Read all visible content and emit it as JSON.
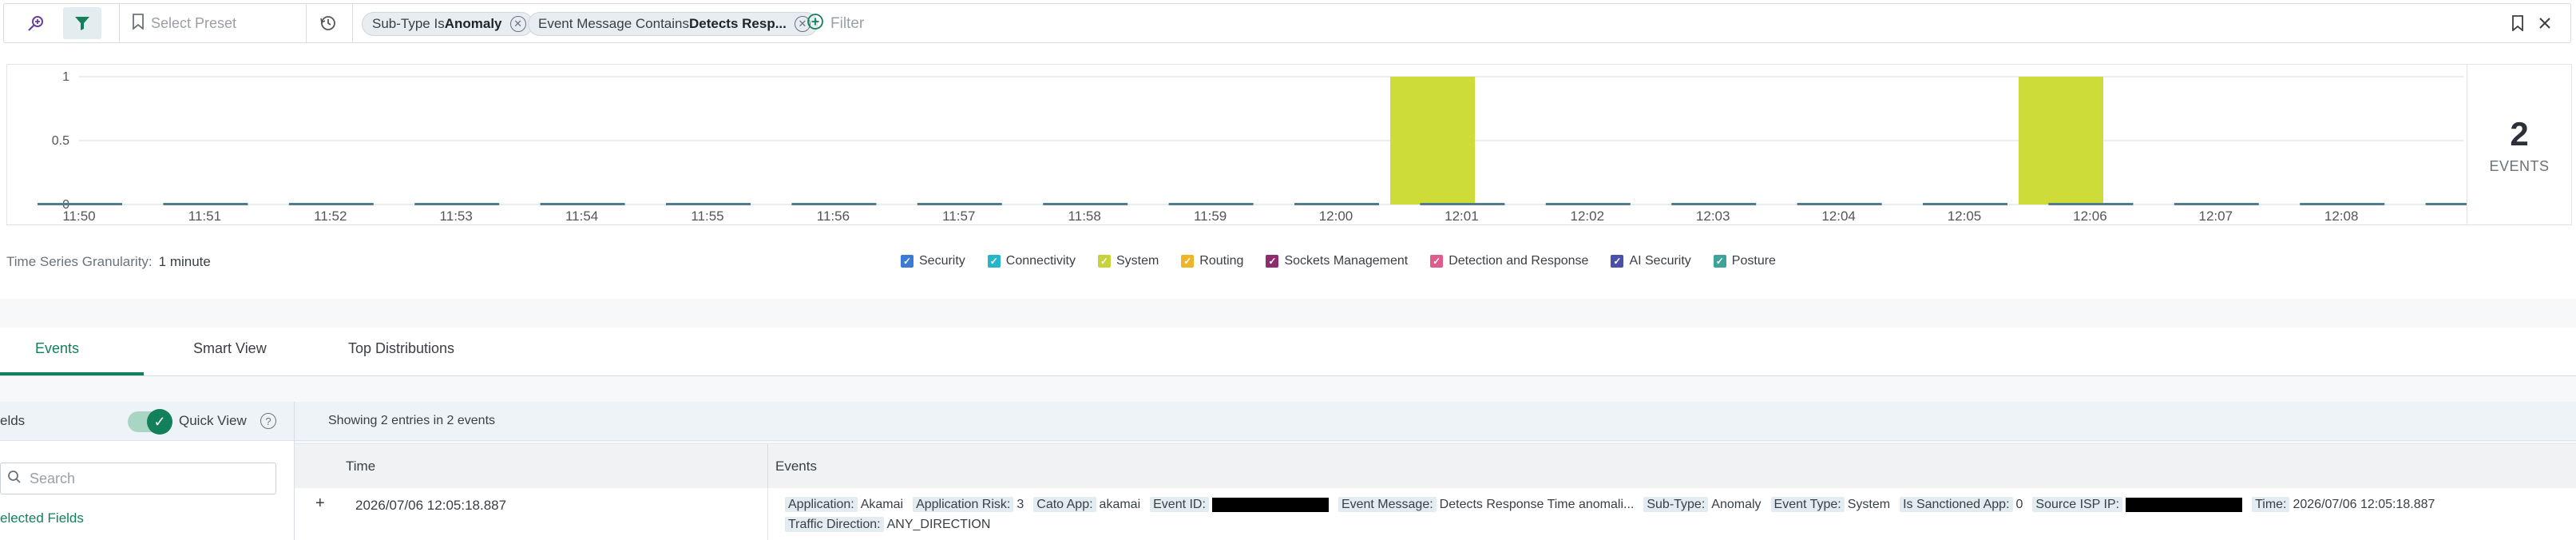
{
  "filter_bar": {
    "preset_placeholder": "Select Preset",
    "chips": [
      {
        "prefix": "Sub-Type Is ",
        "value": "Anomaly"
      },
      {
        "prefix": "Event Message Contains ",
        "value": "Detects Resp..."
      }
    ],
    "filter_placeholder": "Filter",
    "icons": [
      "search-plus-icon",
      "filter-icon",
      "bookmark-icon",
      "history-icon",
      "add-circle-icon",
      "bookmark-icon",
      "close-icon"
    ]
  },
  "chart_data": {
    "type": "bar",
    "categories": [
      "11:50",
      "11:51",
      "11:52",
      "11:53",
      "11:54",
      "11:55",
      "11:56",
      "11:57",
      "11:58",
      "11:59",
      "12:00",
      "12:01",
      "12:02",
      "12:03",
      "12:04",
      "12:05",
      "12:06",
      "12:07",
      "12:08"
    ],
    "values": [
      0,
      0,
      0,
      0,
      0,
      0,
      0,
      0,
      0,
      0,
      1,
      0,
      0,
      0,
      0,
      1,
      0,
      0,
      0
    ],
    "yticks": [
      "0",
      "0.5",
      "1"
    ],
    "ylim": [
      0,
      1
    ],
    "bar_color": "#cddc39",
    "baseline_color": "#4f7d8f",
    "grid": true
  },
  "summary": {
    "count": "2",
    "label": "EVENTS"
  },
  "granularity": {
    "label": "Time Series Granularity:",
    "value": "1 minute"
  },
  "legend": [
    {
      "label": "Security",
      "color": "#3b7bd6"
    },
    {
      "label": "Connectivity",
      "color": "#26b5c9"
    },
    {
      "label": "System",
      "color": "#c6d33a"
    },
    {
      "label": "Routing",
      "color": "#f0b429"
    },
    {
      "label": "Sockets Management",
      "color": "#8e2d6d"
    },
    {
      "label": "Detection and Response",
      "color": "#e05c8a"
    },
    {
      "label": "AI Security",
      "color": "#4a4fa8"
    },
    {
      "label": "Posture",
      "color": "#3fa39a"
    }
  ],
  "tabs": [
    {
      "label": "Events",
      "active": true
    },
    {
      "label": "Smart View"
    },
    {
      "label": "Top Distributions"
    }
  ],
  "sidebar": {
    "title": "elds",
    "quick_view": "Quick View",
    "search_placeholder": "Search",
    "selected_fields": "elected Fields"
  },
  "results": {
    "summary": "Showing 2 entries in 2 events",
    "columns": [
      "Time",
      "Events"
    ],
    "rows": [
      {
        "time": "2026/07/06 12:05:18.887",
        "fields": [
          {
            "k": "Application:",
            "v": "Akamai"
          },
          {
            "k": "Application Risk:",
            "v": "3"
          },
          {
            "k": "Cato App:",
            "v": "akamai"
          },
          {
            "k": "Event ID:",
            "v": "",
            "redacted": true
          },
          {
            "k": "Event Message:",
            "v": "Detects Response Time anomali..."
          },
          {
            "k": "Sub-Type:",
            "v": "Anomaly"
          },
          {
            "k": "Event Type:",
            "v": "System"
          },
          {
            "k": "Is Sanctioned App:",
            "v": "0"
          },
          {
            "k": "Source ISP IP:",
            "v": "",
            "redacted": true
          },
          {
            "k": "Time:",
            "v": "2026/07/06 12:05:18.887"
          }
        ],
        "fields_line2": [
          {
            "k": "Traffic Direction:",
            "v": "ANY_DIRECTION"
          }
        ]
      }
    ]
  }
}
